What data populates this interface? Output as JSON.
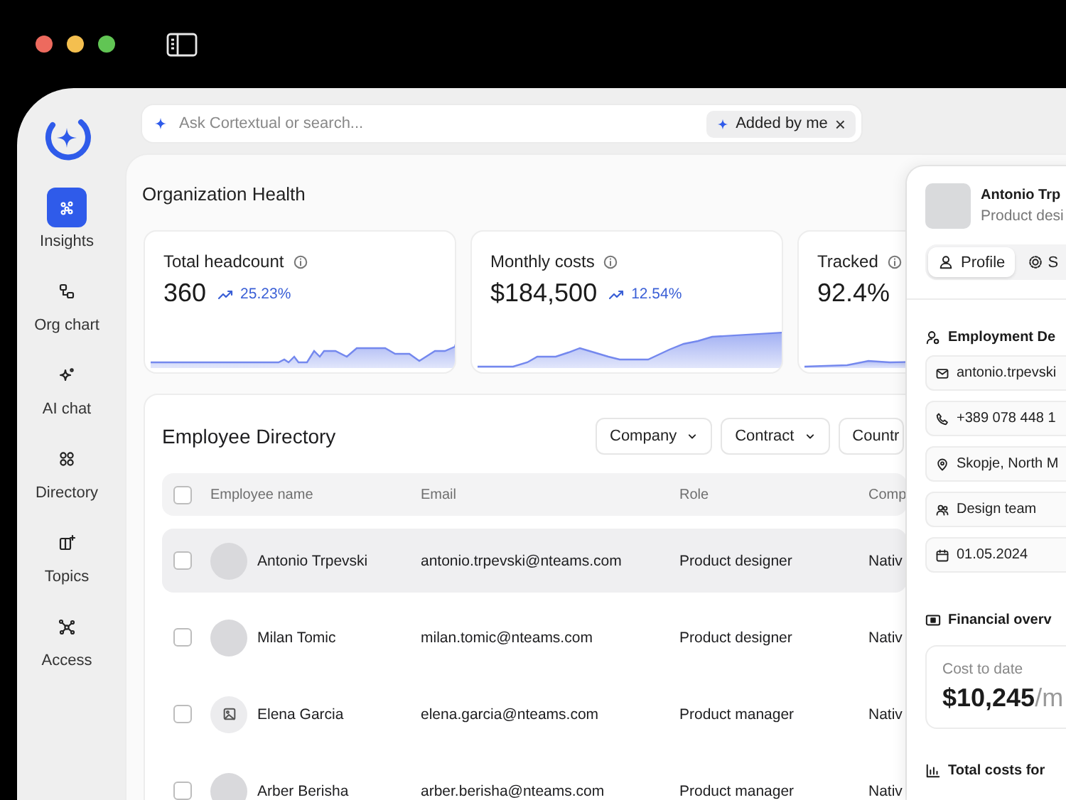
{
  "sidebar": {
    "items": [
      {
        "label": "Insights",
        "selected": true
      },
      {
        "label": "Org chart",
        "selected": false
      },
      {
        "label": "AI chat",
        "selected": false
      },
      {
        "label": "Directory",
        "selected": false
      },
      {
        "label": "Topics",
        "selected": false
      },
      {
        "label": "Access",
        "selected": false
      }
    ]
  },
  "search": {
    "placeholder": "Ask Cortextual or search...",
    "chip": {
      "label": "Added by me",
      "remove": "×"
    }
  },
  "page_title": "Organization Health",
  "metrics": [
    {
      "label": "Total headcount",
      "value": "360",
      "change": "25.23%"
    },
    {
      "label": "Monthly costs",
      "value": "$184,500",
      "change": "12.54%"
    },
    {
      "label": "Tracked",
      "value": "92.4%"
    }
  ],
  "directory": {
    "title": "Employee Directory",
    "filters": [
      "Company",
      "Contract",
      "Countr"
    ],
    "columns": [
      "Employee name",
      "Email",
      "Role",
      "Comp"
    ],
    "header_checked": false,
    "rows": [
      {
        "name": "Antonio Trpevski",
        "email": "antonio.trpevski@nteams.com",
        "role": "Product designer",
        "company": "Nativ",
        "kind": "photo",
        "selected": true,
        "checked": false
      },
      {
        "name": "Milan Tomic",
        "email": "milan.tomic@nteams.com",
        "role": "Product designer",
        "company": "Nativ",
        "kind": "photo",
        "selected": false,
        "checked": false
      },
      {
        "name": "Elena Garcia",
        "email": "elena.garcia@nteams.com",
        "role": "Product manager",
        "company": "Nativ",
        "kind": "placeholder",
        "selected": false,
        "checked": false
      },
      {
        "name": "Arber Berisha",
        "email": "arber.berisha@nteams.com",
        "role": "Product manager",
        "company": "Nativ",
        "kind": "photo",
        "selected": false,
        "checked": false
      }
    ]
  },
  "profile": {
    "name": "Antonio Trp",
    "role": "Product desi",
    "tabs": [
      {
        "label": "Profile",
        "selected": true
      },
      {
        "label": "S",
        "selected": false
      }
    ],
    "employment_title": "Employment De",
    "fields": [
      {
        "kind": "email",
        "value": "antonio.trpevski"
      },
      {
        "kind": "phone",
        "value": "+389 078 448 1"
      },
      {
        "kind": "location",
        "value": "Skopje, North M"
      },
      {
        "kind": "team",
        "value": "Design team"
      },
      {
        "kind": "date",
        "value": "01.05.2024"
      }
    ],
    "financial_title": "Financial overv",
    "cost": {
      "label": "Cost to date",
      "value": "$10,245",
      "unit": "/m"
    },
    "costs_title": "Total costs for"
  }
}
